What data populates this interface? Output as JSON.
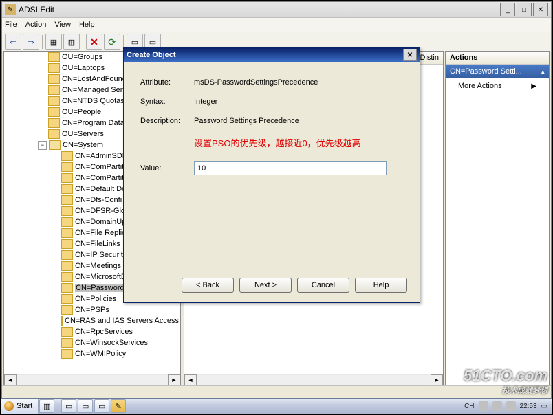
{
  "window": {
    "title": "ADSI Edit"
  },
  "menu": {
    "file": "File",
    "action": "Action",
    "view": "View",
    "help": "Help"
  },
  "tree": {
    "items": [
      {
        "indent": 64,
        "label": "OU=Groups"
      },
      {
        "indent": 64,
        "label": "OU=Laptops"
      },
      {
        "indent": 64,
        "label": "CN=LostAndFound"
      },
      {
        "indent": 64,
        "label": "CN=Managed Serv"
      },
      {
        "indent": 64,
        "label": "CN=NTDS Quotas"
      },
      {
        "indent": 64,
        "label": "OU=People"
      },
      {
        "indent": 64,
        "label": "CN=Program Data"
      },
      {
        "indent": 64,
        "label": "OU=Servers"
      },
      {
        "indent": 64,
        "label": "CN=System",
        "expandable": true,
        "minus": true,
        "open": true
      },
      {
        "indent": 83,
        "label": "CN=AdminSDH"
      },
      {
        "indent": 83,
        "label": "CN=ComPartit"
      },
      {
        "indent": 83,
        "label": "CN=ComPartit"
      },
      {
        "indent": 83,
        "label": "CN=Default Do"
      },
      {
        "indent": 83,
        "label": "CN=Dfs-Confi"
      },
      {
        "indent": 83,
        "label": "CN=DFSR-Glo"
      },
      {
        "indent": 83,
        "label": "CN=DomainUp"
      },
      {
        "indent": 83,
        "label": "CN=File Replic"
      },
      {
        "indent": 83,
        "label": "CN=FileLinks"
      },
      {
        "indent": 83,
        "label": "CN=IP Securit"
      },
      {
        "indent": 83,
        "label": "CN=Meetings"
      },
      {
        "indent": 83,
        "label": "CN=MicrosoftD"
      },
      {
        "indent": 83,
        "label": "CN=Password",
        "selected": true
      },
      {
        "indent": 83,
        "label": "CN=Policies"
      },
      {
        "indent": 83,
        "label": "CN=PSPs"
      },
      {
        "indent": 83,
        "label": "CN=RAS and IAS Servers Access Che"
      },
      {
        "indent": 83,
        "label": "CN=RpcServices"
      },
      {
        "indent": 83,
        "label": "CN=WinsockServices"
      },
      {
        "indent": 83,
        "label": "CN=WMIPolicy"
      }
    ]
  },
  "mid": {
    "col": "Distin"
  },
  "actions": {
    "title": "Actions",
    "context": "CN=Password Setti...",
    "more": "More Actions"
  },
  "dialog": {
    "title": "Create Object",
    "attr_lbl": "Attribute:",
    "attr_val": "msDS-PasswordSettingsPrecedence",
    "syntax_lbl": "Syntax:",
    "syntax_val": "Integer",
    "desc_lbl": "Description:",
    "desc_val": "Password Settings Precedence",
    "hint": "设置PSO的优先级，越接近0，优先级越高",
    "value_lbl": "Value:",
    "value": "10",
    "back": "< Back",
    "next": "Next >",
    "cancel": "Cancel",
    "help": "Help"
  },
  "taskbar": {
    "start": "Start",
    "lang": "CH",
    "time": "22:53"
  },
  "watermark": {
    "main": "51CTO.com",
    "sub": "技术成就梦想"
  }
}
